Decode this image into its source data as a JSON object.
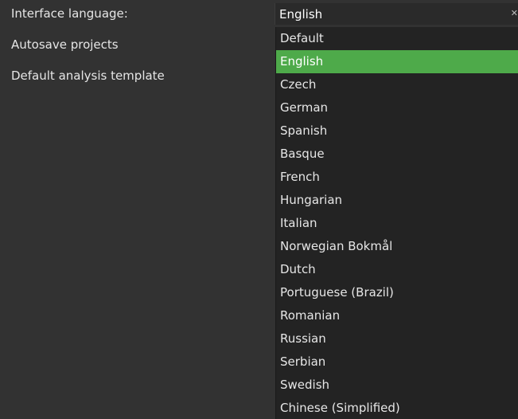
{
  "settings": {
    "rows": [
      {
        "label": "Interface language:"
      },
      {
        "label": "Autosave projects"
      },
      {
        "label": "Default analysis template"
      }
    ]
  },
  "language_combo": {
    "value": "English",
    "arrow_icon": "close-icon"
  },
  "dropdown": {
    "selected_index": 1,
    "options": [
      {
        "label": "Default"
      },
      {
        "label": "English"
      },
      {
        "label": "Czech"
      },
      {
        "label": "German"
      },
      {
        "label": "Spanish"
      },
      {
        "label": "Basque"
      },
      {
        "label": "French"
      },
      {
        "label": "Hungarian"
      },
      {
        "label": "Italian"
      },
      {
        "label": "Norwegian Bokmål"
      },
      {
        "label": "Dutch"
      },
      {
        "label": "Portuguese (Brazil)"
      },
      {
        "label": "Romanian"
      },
      {
        "label": "Russian"
      },
      {
        "label": "Serbian"
      },
      {
        "label": "Swedish"
      },
      {
        "label": "Chinese (Simplified)"
      }
    ]
  },
  "colors": {
    "background": "#323232",
    "dropdown_bg": "#232323",
    "selection": "#4eaa4a",
    "text": "#e6e6e6"
  }
}
